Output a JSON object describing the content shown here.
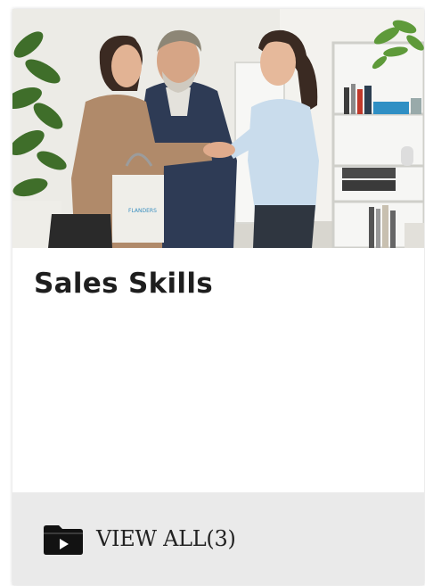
{
  "card": {
    "title": "Sales Skills",
    "image_alt": "Business people shaking hands in an office",
    "bag_logo": "FLANDERS",
    "footer": {
      "icon": "video-folder-icon",
      "view_all_label": "VIEW ALL(3)"
    }
  }
}
